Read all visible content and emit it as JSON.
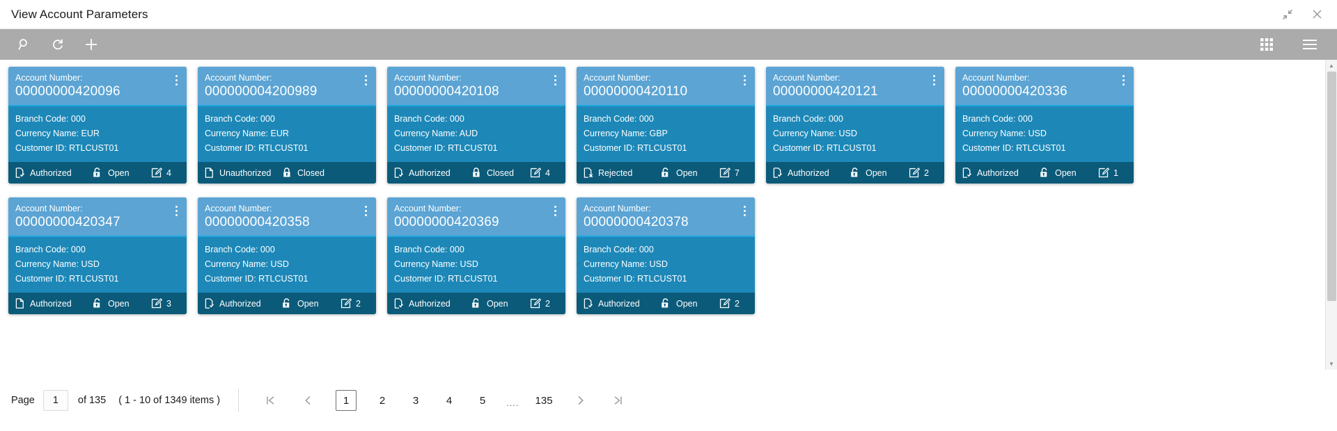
{
  "window": {
    "title": "View Account Parameters",
    "restore_icon": "restore-down-icon",
    "close_icon": "close-icon"
  },
  "toolbar": {
    "left": [
      {
        "name": "search-icon",
        "label": "Search"
      },
      {
        "name": "refresh-icon",
        "label": "Refresh"
      },
      {
        "name": "add-icon",
        "label": "Add"
      }
    ],
    "right": [
      {
        "name": "tile-view-icon",
        "label": "Tile View"
      },
      {
        "name": "list-view-icon",
        "label": "List View"
      }
    ]
  },
  "card_fields": {
    "account_label": "Account Number:",
    "branch_label": "Branch Code:",
    "currency_label": "Currency Name:",
    "customer_label": "Customer ID:"
  },
  "colors": {
    "card_header": "#5ba4d4",
    "card_divider": "#1ba7e0",
    "card_body": "#1d88b8",
    "card_footer": "#0b5a79",
    "toolbar": "#ababab"
  },
  "cards": [
    {
      "account_number": "00000000420096",
      "branch_code": "000",
      "currency_name": "EUR",
      "customer_id": "RTLCUST01",
      "auth_status": "Authorized",
      "auth_icon": "document-check-icon",
      "lock_status": "Open",
      "lock_icon": "unlock-icon",
      "mod_count": "4",
      "mod_icon": "edit-icon"
    },
    {
      "account_number": "000000004200989",
      "branch_code": "000",
      "currency_name": "EUR",
      "customer_id": "RTLCUST01",
      "auth_status": "Unauthorized",
      "auth_icon": "document-icon",
      "lock_status": "Closed",
      "lock_icon": "lock-icon",
      "mod_count": "",
      "mod_icon": ""
    },
    {
      "account_number": "00000000420108",
      "branch_code": "000",
      "currency_name": "AUD",
      "customer_id": "RTLCUST01",
      "auth_status": "Authorized",
      "auth_icon": "document-check-icon",
      "lock_status": "Closed",
      "lock_icon": "lock-icon",
      "mod_count": "4",
      "mod_icon": "edit-icon"
    },
    {
      "account_number": "00000000420110",
      "branch_code": "000",
      "currency_name": "GBP",
      "customer_id": "RTLCUST01",
      "auth_status": "Rejected",
      "auth_icon": "document-x-icon",
      "lock_status": "Open",
      "lock_icon": "unlock-icon",
      "mod_count": "7",
      "mod_icon": "edit-icon"
    },
    {
      "account_number": "00000000420121",
      "branch_code": "000",
      "currency_name": "USD",
      "customer_id": "RTLCUST01",
      "auth_status": "Authorized",
      "auth_icon": "document-check-icon",
      "lock_status": "Open",
      "lock_icon": "unlock-icon",
      "mod_count": "2",
      "mod_icon": "edit-icon"
    },
    {
      "account_number": "00000000420336",
      "branch_code": "000",
      "currency_name": "USD",
      "customer_id": "RTLCUST01",
      "auth_status": "Authorized",
      "auth_icon": "document-check-icon",
      "lock_status": "Open",
      "lock_icon": "unlock-icon",
      "mod_count": "1",
      "mod_icon": "edit-icon"
    },
    {
      "account_number": "00000000420347",
      "branch_code": "000",
      "currency_name": "USD",
      "customer_id": "RTLCUST01",
      "auth_status": "Authorized",
      "auth_icon": "document-icon",
      "lock_status": "Open",
      "lock_icon": "unlock-icon",
      "mod_count": "3",
      "mod_icon": "edit-icon"
    },
    {
      "account_number": "00000000420358",
      "branch_code": "000",
      "currency_name": "USD",
      "customer_id": "RTLCUST01",
      "auth_status": "Authorized",
      "auth_icon": "document-check-icon",
      "lock_status": "Open",
      "lock_icon": "unlock-icon",
      "mod_count": "2",
      "mod_icon": "edit-icon"
    },
    {
      "account_number": "00000000420369",
      "branch_code": "000",
      "currency_name": "USD",
      "customer_id": "RTLCUST01",
      "auth_status": "Authorized",
      "auth_icon": "document-check-icon",
      "lock_status": "Open",
      "lock_icon": "unlock-icon",
      "mod_count": "2",
      "mod_icon": "edit-icon"
    },
    {
      "account_number": "00000000420378",
      "branch_code": "000",
      "currency_name": "USD",
      "customer_id": "RTLCUST01",
      "auth_status": "Authorized",
      "auth_icon": "document-check-icon",
      "lock_status": "Open",
      "lock_icon": "unlock-icon",
      "mod_count": "2",
      "mod_icon": "edit-icon"
    }
  ],
  "pagination": {
    "page_label": "Page",
    "page_value": "1",
    "of_text": "of 135",
    "items_text": "( 1 - 10 of 1349 items )",
    "first_icon": "first-page-icon",
    "prev_icon": "prev-page-icon",
    "next_icon": "next-page-icon",
    "last_icon": "last-page-icon",
    "pages": [
      "1",
      "2",
      "3",
      "4",
      "5"
    ],
    "ellipsis": "....",
    "last_page": "135",
    "active_page": "1"
  }
}
